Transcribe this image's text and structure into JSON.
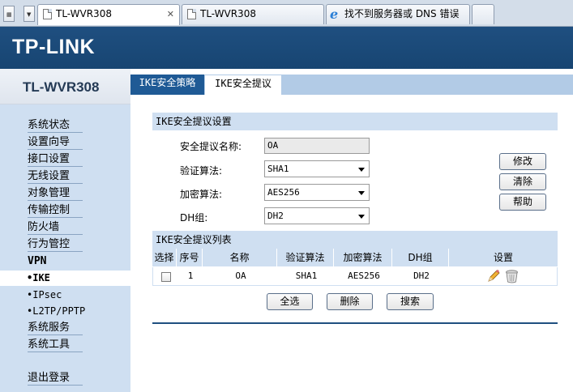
{
  "browser": {
    "tabs": [
      {
        "label": "TL-WVR308",
        "close": "✕"
      },
      {
        "label": "TL-WVR308"
      },
      {
        "label": "找不到服务器或 DNS 错误"
      }
    ]
  },
  "header": {
    "logo": "TP-LINK"
  },
  "sidebar": {
    "model": "TL-WVR308",
    "items": [
      {
        "label": "系统状态"
      },
      {
        "label": "设置向导"
      },
      {
        "label": "接口设置"
      },
      {
        "label": "无线设置"
      },
      {
        "label": "对象管理"
      },
      {
        "label": "传输控制"
      },
      {
        "label": "防火墙"
      },
      {
        "label": "行为管控"
      },
      {
        "label": "VPN"
      },
      {
        "label": "系统服务"
      },
      {
        "label": "系统工具"
      },
      {
        "label": "退出登录"
      }
    ],
    "vpn_sub": [
      {
        "label": "•IKE"
      },
      {
        "label": "•IPsec"
      },
      {
        "label": "•L2TP/PPTP"
      }
    ]
  },
  "content_tabs": [
    {
      "label": "IKE安全策略"
    },
    {
      "label": "IKE安全提议"
    }
  ],
  "settings": {
    "title": "IKE安全提议设置",
    "name_label": "安全提议名称:",
    "name_value": "OA",
    "auth_label": "验证算法:",
    "auth_value": "SHA1",
    "enc_label": "加密算法:",
    "enc_value": "AES256",
    "dh_label": "DH组:",
    "dh_value": "DH2",
    "modify": "修改",
    "clear": "清除",
    "help": "帮助"
  },
  "list": {
    "title": "IKE安全提议列表",
    "columns": [
      "选择",
      "序号",
      "名称",
      "验证算法",
      "加密算法",
      "DH组",
      "设置"
    ],
    "rows": [
      {
        "index": "1",
        "name": "OA",
        "auth": "SHA1",
        "enc": "AES256",
        "dh": "DH2"
      }
    ],
    "select_all": "全选",
    "delete": "删除",
    "search": "搜索"
  },
  "colors": {
    "brand": "#1f4f80",
    "nav_bg": "#cfdff1",
    "active_tab": "#1f5a95"
  }
}
